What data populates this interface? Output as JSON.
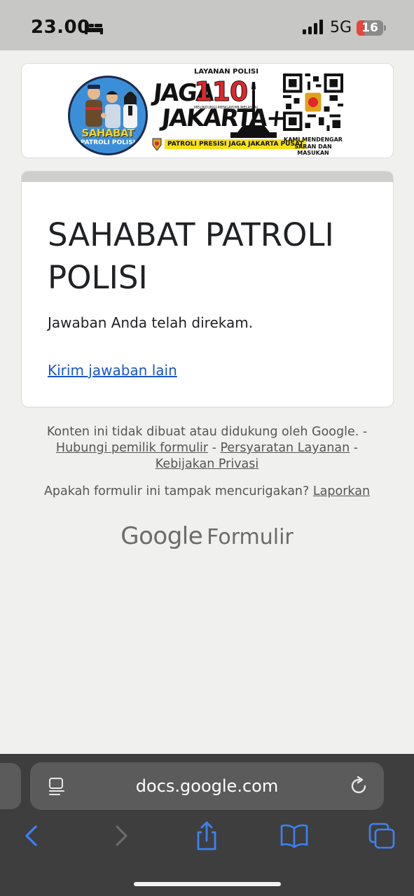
{
  "status_bar": {
    "time": "23.00",
    "network": "5G",
    "battery_level": "16",
    "battery_fraction": 0.16
  },
  "banner": {
    "badge_line1": "SAHABAT",
    "badge_line2": "PATROLI POLISI",
    "service_label": "LAYANAN POLISI",
    "service_number": "110",
    "tagline": "MELINDUNGI-MENGAYOMI-MELAYANI",
    "jaga": "JAGA",
    "jakarta": "JAKARTA+",
    "strip_text": "PATROLI PRESISI JAGA JAKARTA PUSAT",
    "qr_caption_line1": "KAMI MENDENGAR",
    "qr_caption_line2": "SARAN DAN MASUKAN"
  },
  "form": {
    "title": "SAHABAT PATROLI POLISI",
    "confirmation": "Jawaban Anda telah direkam.",
    "another_response_link": "Kirim jawaban lain"
  },
  "footer": {
    "disclaimer": "Konten ini tidak dibuat atau didukung oleh Google. -",
    "contact_owner": "Hubungi pemilik formulir",
    "terms": "Persyaratan Layanan",
    "privacy": "Kebijakan Privasi",
    "separator": " - ",
    "report_question": "Apakah formulir ini tampak mencurigakan?",
    "report_link": "Laporkan",
    "logo_google": "Google",
    "logo_forms": "Formulir"
  },
  "browser": {
    "url": "docs.google.com",
    "accent_color": "#3b82f6",
    "icons": [
      "page-menu-icon",
      "reload-icon",
      "back-icon",
      "forward-icon",
      "share-icon",
      "bookmarks-icon",
      "tabs-icon"
    ]
  }
}
